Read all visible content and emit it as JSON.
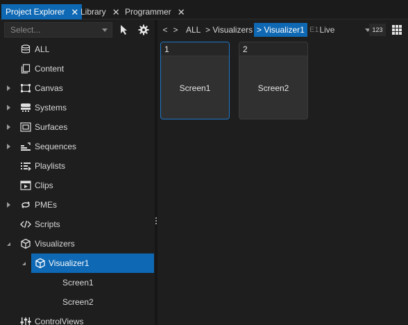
{
  "tabs": [
    {
      "label": "Project Explorer",
      "active": true
    },
    {
      "label": "Library",
      "active": false
    },
    {
      "label": "Programmer",
      "active": false
    }
  ],
  "explorer": {
    "select_placeholder": "Select...",
    "tree": [
      {
        "label": "ALL",
        "icon": "database-icon",
        "expander": "none"
      },
      {
        "label": "Content",
        "icon": "content-icon",
        "expander": "none"
      },
      {
        "label": "Canvas",
        "icon": "canvas-icon",
        "expander": "collapsed"
      },
      {
        "label": "Systems",
        "icon": "systems-icon",
        "expander": "collapsed"
      },
      {
        "label": "Surfaces",
        "icon": "surfaces-icon",
        "expander": "collapsed"
      },
      {
        "label": "Sequences",
        "icon": "sequences-icon",
        "expander": "collapsed"
      },
      {
        "label": "Playlists",
        "icon": "playlists-icon",
        "expander": "none"
      },
      {
        "label": "Clips",
        "icon": "clips-icon",
        "expander": "none"
      },
      {
        "label": "PMEs",
        "icon": "pmes-icon",
        "expander": "collapsed"
      },
      {
        "label": "Scripts",
        "icon": "scripts-icon",
        "expander": "none"
      },
      {
        "label": "Visualizers",
        "icon": "cube-icon",
        "expander": "expanded"
      },
      {
        "label": "Visualizer1",
        "icon": "cube-icon",
        "expander": "expanded",
        "selected": true
      },
      {
        "label": "Screen1",
        "icon": "",
        "expander": "none"
      },
      {
        "label": "Screen2",
        "icon": "",
        "expander": "none"
      },
      {
        "label": "ControlViews",
        "icon": "controlviews-icon",
        "expander": "none"
      }
    ]
  },
  "breadcrumb": {
    "back": "<",
    "forward": ">",
    "items": [
      "ALL",
      "> Visualizers",
      "> Visualizer1"
    ]
  },
  "live_select": {
    "prefix": "E1",
    "value": "Live"
  },
  "number_toggle": "123",
  "tiles": [
    {
      "number": "1",
      "name": "Screen1",
      "selected": true
    },
    {
      "number": "2",
      "name": "Screen2",
      "selected": false
    }
  ],
  "colors": {
    "accent": "#0e68b4",
    "background": "#1e1e1e",
    "tile": "#303030"
  }
}
